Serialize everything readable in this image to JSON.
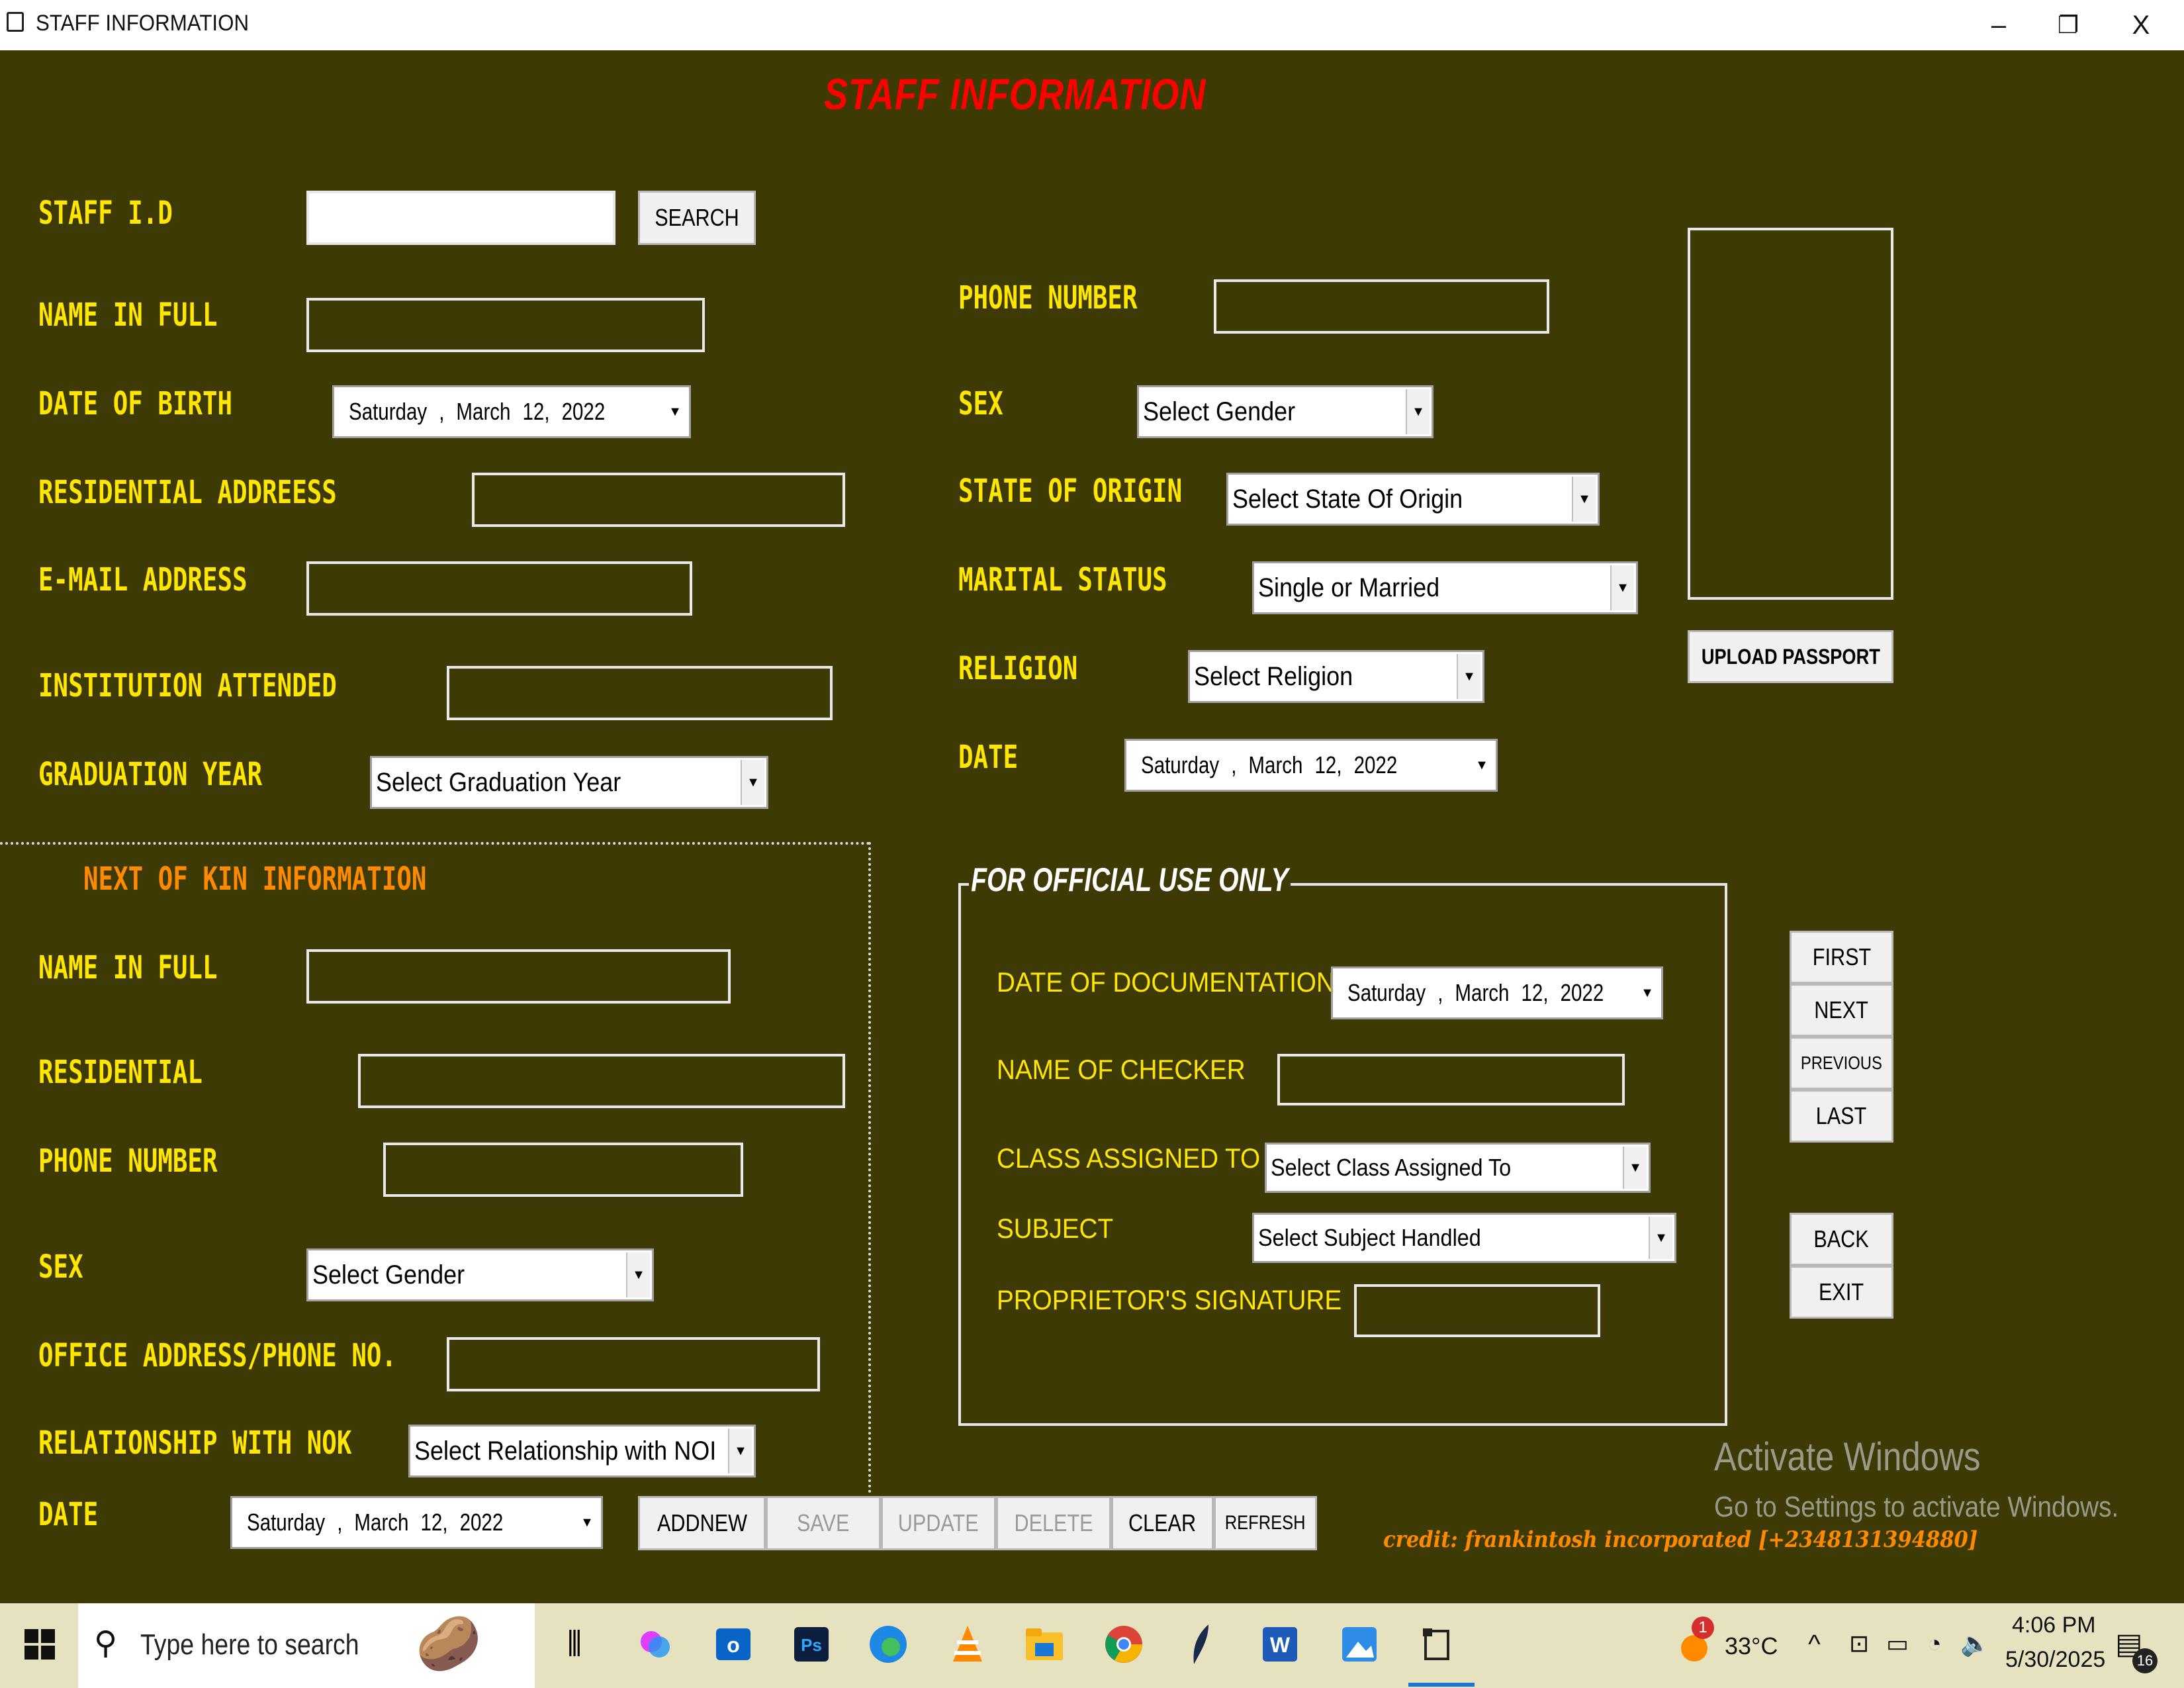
{
  "window": {
    "title": "STAFF INFORMATION",
    "controls": {
      "minimize": "–",
      "restore": "❐",
      "close": "X"
    }
  },
  "form": {
    "heading": "STAFF INFORMATION",
    "staff_id_label": "STAFF I.D",
    "search_button": "SEARCH",
    "name_label": "NAME IN FULL",
    "dob_label": "DATE OF BIRTH",
    "dob_value": "Saturday ,   March   12, 2022",
    "address_label": "RESIDENTIAL ADDREESS",
    "email_label": "E-MAIL ADDRESS",
    "institution_label": "INSTITUTION ATTENDED",
    "grad_year_label": "GRADUATION YEAR",
    "grad_year_value": "Select Graduation Year",
    "phone_label": "PHONE NUMBER",
    "sex_label": "SEX",
    "sex_value": "Select Gender",
    "state_label": "STATE OF ORIGIN",
    "state_value": "Select State Of Origin",
    "marital_label": "MARITAL STATUS",
    "marital_value": "Single or Married",
    "religion_label": "RELIGION",
    "religion_value": "Select Religion",
    "date_label": "DATE",
    "date_value": "Saturday ,   March   12, 2022",
    "upload_button": "UPLOAD PASSPORT"
  },
  "nok": {
    "heading": "NEXT OF KIN INFORMATION",
    "name_label": "NAME IN FULL",
    "residential_label": "RESIDENTIAL",
    "phone_label": "PHONE NUMBER",
    "sex_label": "SEX",
    "sex_value": "Select Gender",
    "office_label": "OFFICE ADDRESS/PHONE NO.",
    "relationship_label": "RELATIONSHIP WITH NOK",
    "relationship_value": "Select Relationship with NOI",
    "date_label": "DATE",
    "date_value": "Saturday ,   March   12, 2022"
  },
  "official": {
    "heading": "FOR OFFICIAL USE ONLY",
    "doc_date_label": "DATE OF DOCUMENTATION",
    "doc_date_value": "Saturday ,   March   12, 2022",
    "checker_label": "NAME OF CHECKER",
    "class_label": "CLASS ASSIGNED TO",
    "class_value": "Select Class Assigned To",
    "subject_label": "SUBJECT",
    "subject_value": "Select Subject Handled",
    "signature_label": "PROPRIETOR'S SIGNATURE"
  },
  "nav_buttons": [
    "FIRST",
    "NEXT",
    "PREVIOUS",
    "LAST"
  ],
  "side_buttons": [
    "BACK",
    "EXIT"
  ],
  "action_buttons": [
    {
      "label": "ADDNEW",
      "enabled": true
    },
    {
      "label": "SAVE",
      "enabled": false
    },
    {
      "label": "UPDATE",
      "enabled": false
    },
    {
      "label": "DELETE",
      "enabled": false
    },
    {
      "label": "CLEAR",
      "enabled": true
    },
    {
      "label": "REFRESH",
      "enabled": true
    }
  ],
  "watermark": {
    "line1": "Activate Windows",
    "line2": "Go to Settings to activate Windows."
  },
  "credit": "credit: frankintosh incorporated [+2348131394880]",
  "taskbar": {
    "search_placeholder": "Type here to search",
    "icons": [
      "windows-start-icon",
      "search-icon",
      "task-view-icon",
      "copilot-icon",
      "outlook-icon",
      "photoshop-icon",
      "edge-icon",
      "vlc-icon",
      "file-explorer-icon",
      "chrome-icon",
      "feather-icon",
      "word-icon",
      "photos-icon",
      "app-window-icon"
    ],
    "weather": "33°C",
    "weather_badge": "1",
    "time": "4:06 PM",
    "date": "5/30/2025",
    "notification_count": "16"
  },
  "colors": {
    "background": "#3d3a06",
    "label": "#ffe600",
    "heading": "#ff0000",
    "nok_heading": "#ff8a00"
  }
}
